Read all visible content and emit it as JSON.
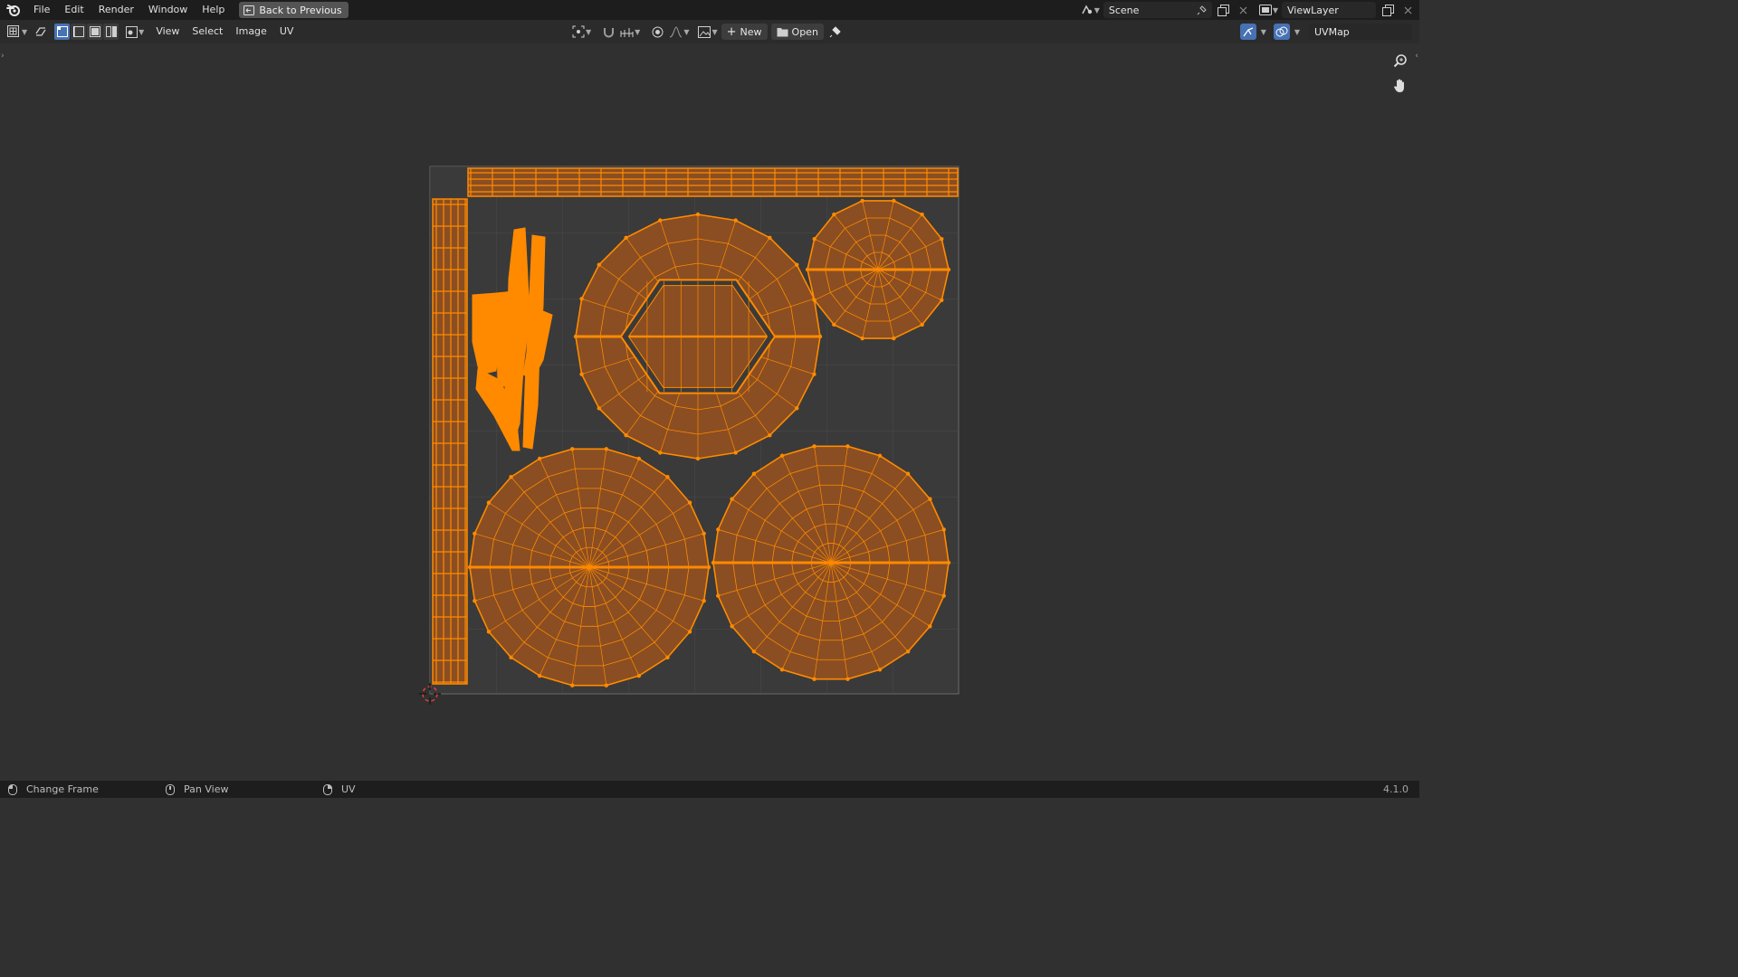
{
  "topbar": {
    "menus": [
      "File",
      "Edit",
      "Render",
      "Window",
      "Help"
    ],
    "back_label": "Back to Previous",
    "scene_name": "Scene",
    "view_layer_name": "ViewLayer"
  },
  "header": {
    "menus": [
      "View",
      "Select",
      "Image",
      "UV"
    ],
    "new_label": "New",
    "open_label": "Open",
    "uv_map_name": "UVMap"
  },
  "status": {
    "left_label": "Change Frame",
    "middle_label": "Pan View",
    "right_label": "UV",
    "version": "4.1.0"
  },
  "colors": {
    "accent": "#4772b3",
    "uv_face": "#8a4e22",
    "uv_edge": "#ff8a00",
    "background": "#303030"
  }
}
